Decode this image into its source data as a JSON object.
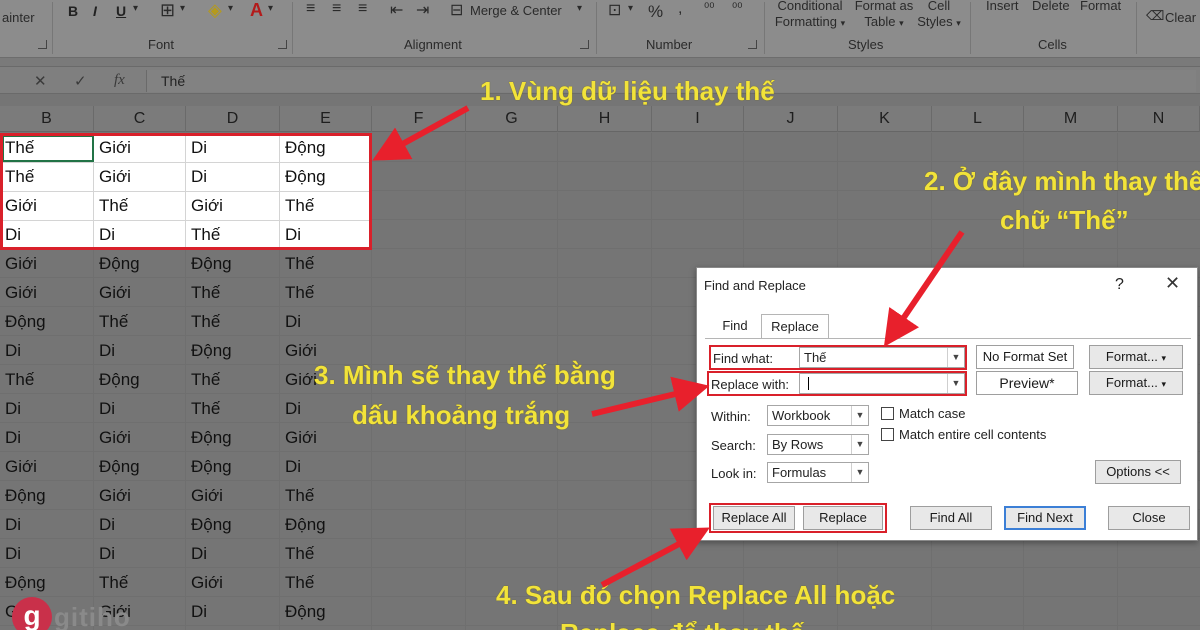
{
  "ribbon": {
    "painter_label": "ainter",
    "font_group": "Font",
    "alignment_group": "Alignment",
    "number_group": "Number",
    "styles_group": "Styles",
    "cells_group": "Cells",
    "merge_center": "Merge & Center",
    "conditional_formatting_line1": "Conditional",
    "conditional_formatting_line2": "Formatting",
    "format_as_table_line1": "Format as",
    "format_as_table_line2": "Table",
    "cell_styles_line1": "Cell",
    "cell_styles_line2": "Styles",
    "insert": "Insert",
    "delete": "Delete",
    "format": "Format",
    "clear": "Clear",
    "bold": "B",
    "italic": "I",
    "underline": "U",
    "percent": "%"
  },
  "formula_bar": {
    "cancel_icon": "✕",
    "enter_icon": "✓",
    "fx_label": "fx",
    "value": "Thế"
  },
  "columns": [
    "B",
    "C",
    "D",
    "E",
    "F",
    "G",
    "H",
    "I",
    "J",
    "K",
    "L",
    "M",
    "N"
  ],
  "rows": [
    [
      "Thế",
      "Giới",
      "Di",
      "Động"
    ],
    [
      "Thế",
      "Giới",
      "Di",
      "Động"
    ],
    [
      "Giới",
      "Thế",
      "Giới",
      "Thế"
    ],
    [
      "Di",
      "Di",
      "Thế",
      "Di"
    ],
    [
      "Giới",
      "Động",
      "Động",
      "Thế"
    ],
    [
      "Giới",
      "Giới",
      "Thế",
      "Thế"
    ],
    [
      "Động",
      "Thế",
      "Thế",
      "Di"
    ],
    [
      "Di",
      "Di",
      "Động",
      "Giới"
    ],
    [
      "Thế",
      "Động",
      "Thế",
      "Giới"
    ],
    [
      "Di",
      "Di",
      "Thế",
      "Di"
    ],
    [
      "Di",
      "Giới",
      "Động",
      "Giới"
    ],
    [
      "Giới",
      "Động",
      "Động",
      "Di"
    ],
    [
      "Động",
      "Giới",
      "Giới",
      "Thế"
    ],
    [
      "Di",
      "Di",
      "Động",
      "Động"
    ],
    [
      "Di",
      "Di",
      "Di",
      "Thế"
    ],
    [
      "Động",
      "Thế",
      "Giới",
      "Thế"
    ],
    [
      "Giới",
      "Giới",
      "Di",
      "Động"
    ]
  ],
  "annotations": {
    "a1": "1. Vùng dữ liệu thay thế",
    "a2_line1": "2. Ở đây mình thay thế",
    "a2_line2": "chữ “Thế”",
    "a3_line1": "3. Mình sẽ thay thế bằng",
    "a3_line2": "dấu khoảng trắng",
    "a4_line1": "4. Sau đó chọn Replace All hoặc",
    "a4_line2": "Replace để thay thế"
  },
  "dialog": {
    "title": "Find and Replace",
    "help": "?",
    "close": "✕",
    "tab_find": "Find",
    "tab_replace": "Replace",
    "find_what_label": "Find what:",
    "find_what_value": "Thế",
    "replace_with_label": "Replace with:",
    "replace_with_value": "",
    "no_format_set": "No Format Set",
    "preview": "Preview*",
    "format_btn": "Format...",
    "within_label": "Within:",
    "within_value": "Workbook",
    "search_label": "Search:",
    "search_value": "By Rows",
    "lookin_label": "Look in:",
    "lookin_value": "Formulas",
    "match_case": "Match case",
    "match_entire": "Match entire cell contents",
    "options_btn": "Options <<",
    "replace_all": "Replace All",
    "replace": "Replace",
    "find_all": "Find All",
    "find_next": "Find Next",
    "close_btn": "Close"
  },
  "logo": {
    "mark": "g",
    "text": "gitiho"
  },
  "colors": {
    "annotation": "#f2e33a",
    "highlight_border": "#d9202a",
    "arrow": "#e8202c"
  }
}
